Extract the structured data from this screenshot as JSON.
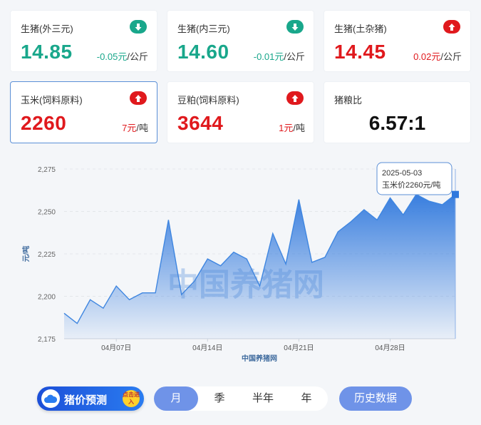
{
  "cards": [
    {
      "name": "生猪(外三元)",
      "price": "14.85",
      "change": "-0.05元",
      "unit": "/公斤",
      "direction": "down"
    },
    {
      "name": "生猪(内三元)",
      "price": "14.60",
      "change": "-0.01元",
      "unit": "/公斤",
      "direction": "down"
    },
    {
      "name": "生猪(土杂猪)",
      "price": "14.45",
      "change": "0.02元",
      "unit": "/公斤",
      "direction": "up"
    },
    {
      "name": "玉米(饲料原料)",
      "price": "2260",
      "change": "7元",
      "unit": "/吨",
      "direction": "up"
    },
    {
      "name": "豆粕(饲料原料)",
      "price": "3644",
      "change": "1元",
      "unit": "/吨",
      "direction": "up"
    },
    {
      "name": "猪粮比",
      "ratio": "6.57:1"
    }
  ],
  "colors": {
    "up": "#e0191d",
    "down": "#19a78b",
    "accent": "#6f93e8",
    "line": "#3f86e0"
  },
  "chart_data": {
    "type": "area",
    "x": [
      "2025-04-03",
      "2025-04-04",
      "2025-04-05",
      "2025-04-06",
      "2025-04-07",
      "2025-04-08",
      "2025-04-09",
      "2025-04-10",
      "2025-04-11",
      "2025-04-12",
      "2025-04-13",
      "2025-04-14",
      "2025-04-15",
      "2025-04-16",
      "2025-04-17",
      "2025-04-18",
      "2025-04-19",
      "2025-04-20",
      "2025-04-21",
      "2025-04-22",
      "2025-04-23",
      "2025-04-24",
      "2025-04-25",
      "2025-04-26",
      "2025-04-27",
      "2025-04-28",
      "2025-04-29",
      "2025-04-30",
      "2025-05-01",
      "2025-05-02",
      "2025-05-03"
    ],
    "y": [
      2190,
      2184,
      2198,
      2193,
      2206,
      2198,
      2202,
      2202,
      2245,
      2201,
      2209,
      2222,
      2218,
      2226,
      2222,
      2206,
      2237,
      2219,
      2257,
      2220,
      2223,
      2238,
      2244,
      2251,
      2245,
      2258,
      2248,
      2260,
      2256,
      2254,
      2260
    ],
    "x_ticks": [
      "04月07日",
      "04月14日",
      "04月21日",
      "04月28日"
    ],
    "y_ticks": [
      "2,175",
      "2,200",
      "2,225",
      "2,250",
      "2,275"
    ],
    "ylim": [
      2175,
      2275
    ],
    "ylabel": "元/吨",
    "xlabel": "中国养猪网",
    "watermark": "中国养猪网",
    "grid": true,
    "tooltip": {
      "date": "2025-05-03",
      "text": "玉米价2260元/吨"
    }
  },
  "controls": {
    "predict_label": "猪价预测",
    "predict_badge": "点击进入",
    "tabs": [
      "月",
      "季",
      "半年",
      "年"
    ],
    "active_tab": "月",
    "history_label": "历史数据"
  }
}
